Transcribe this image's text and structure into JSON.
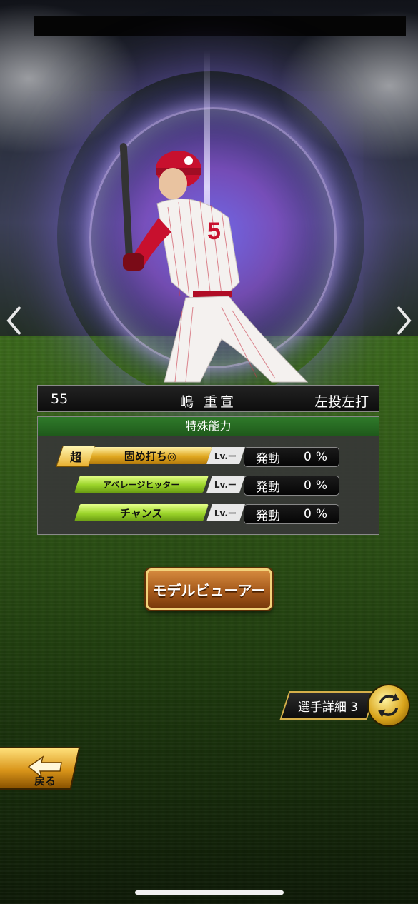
{
  "player": {
    "number": "55",
    "name": "嶋 重宣",
    "handedness": "左投左打",
    "jersey_color": "#c8102e"
  },
  "abilities": {
    "header": "特殊能力",
    "items": [
      {
        "label": "固め打ち◎",
        "badge": "超",
        "level": "Lv.ー",
        "rate_label": "発動",
        "rate_value": "0%",
        "tier": "gold"
      },
      {
        "label": "アベレージヒッター",
        "badge": "",
        "level": "Lv.ー",
        "rate_label": "発動",
        "rate_value": "0%",
        "tier": "green"
      },
      {
        "label": "チャンス",
        "badge": "",
        "level": "Lv.ー",
        "rate_label": "発動",
        "rate_value": "0%",
        "tier": "green"
      }
    ]
  },
  "buttons": {
    "model_viewer": "モデルビューアー",
    "player_detail": "選手詳細 3",
    "back": "戻る"
  },
  "icons": {
    "prev": "chevron-left-icon",
    "next": "chevron-right-icon",
    "switch": "swap-arrows-icon",
    "back": "back-arrow-icon"
  },
  "colors": {
    "accent_green": "#2f7a2a",
    "accent_gold": "#d9a51c",
    "aura": "#8c6eff"
  }
}
